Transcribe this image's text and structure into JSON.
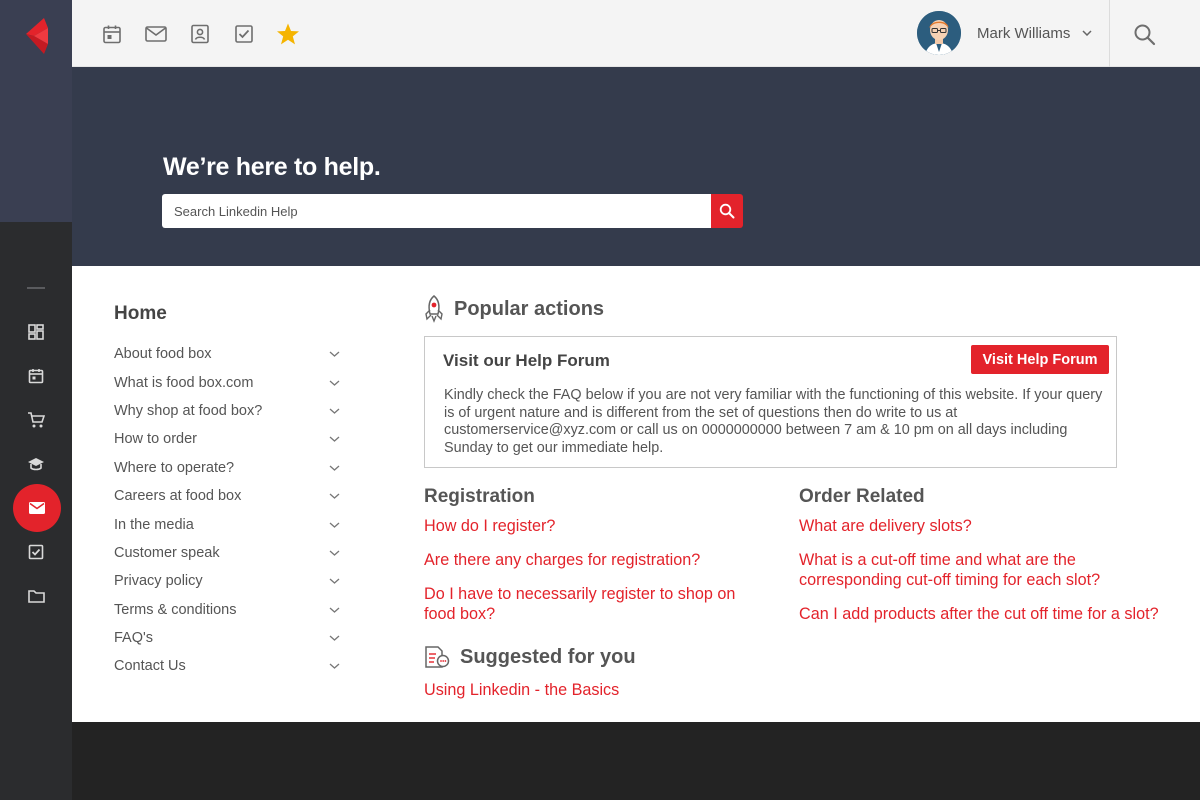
{
  "topbar": {
    "icons": [
      "calendar-icon",
      "mail-icon",
      "contact-card-icon",
      "checkbox-icon",
      "star-icon"
    ],
    "user_name": "Mark Williams"
  },
  "rail": {
    "icons": [
      "dashboard-icon",
      "calendar-icon",
      "cart-icon",
      "graduation-cap-icon",
      "mail-icon",
      "checkbox-icon",
      "folder-icon"
    ],
    "active": "mail-icon"
  },
  "hero": {
    "title": "We’re here to help.",
    "search_placeholder": "Search Linkedin Help"
  },
  "nav": {
    "title": "Home",
    "items": [
      "About food box",
      "What is food box.com",
      "Why shop at food box?",
      "How to order",
      "Where to operate?",
      "Careers at food box",
      "In the media",
      "Customer speak",
      "Privacy policy",
      "Terms & conditions",
      "FAQ's",
      "Contact Us"
    ]
  },
  "popular": {
    "title": "Popular actions",
    "forum_title": "Visit our Help Forum",
    "forum_button": "Visit Help Forum",
    "forum_text": "Kindly check the FAQ below if you are not very familiar with the functioning of this website. If your query is of urgent nature and is different from the set of questions then do write to us at customerservice@xyz.com or call us on 0000000000 between 7 am & 10 pm on all days including Sunday to get our immediate help."
  },
  "registration": {
    "title": "Registration",
    "links": [
      "How do I register?",
      "Are there any charges for registration?",
      "Do I have to necessarily register to shop on food box?"
    ]
  },
  "order": {
    "title": "Order Related",
    "links": [
      "What are delivery slots?",
      "What is a cut-off time and what are the corresponding cut-off timing for each slot?",
      "Can I add products after the cut off time for a slot?"
    ]
  },
  "suggested": {
    "title": "Suggested for you",
    "links": [
      "Using Linkedin - the Basics"
    ]
  },
  "colors": {
    "accent": "#e3232b",
    "rail": "#2b2c2e",
    "rail_top": "#3a3f52",
    "hero": "#343b4c",
    "footer": "#232323"
  }
}
